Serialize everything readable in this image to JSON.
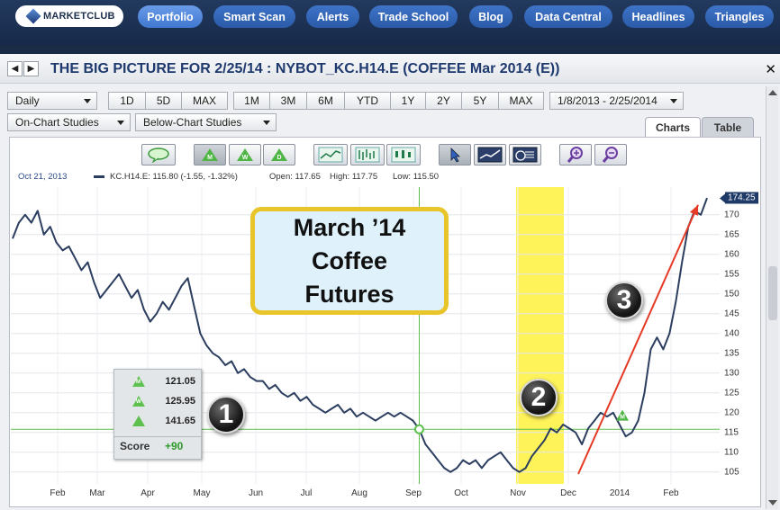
{
  "nav": {
    "logo": "MARKETCLUB",
    "items": [
      "Portfolio",
      "Smart Scan",
      "Alerts",
      "Trade School",
      "Blog",
      "Data Central",
      "Headlines",
      "Triangles"
    ],
    "active": "Portfolio"
  },
  "titlebar": {
    "title": "THE BIG PICTURE FOR 2/25/14 : NYBOT_KC.H14.E (COFFEE Mar 2014 (E))",
    "close": "✕"
  },
  "controls": {
    "period": "Daily",
    "ranges1": [
      "1D",
      "5D",
      "MAX"
    ],
    "ranges2": [
      "1M",
      "3M",
      "6M",
      "YTD",
      "1Y",
      "2Y",
      "5Y",
      "MAX"
    ],
    "date_range": "1/8/2013 - 2/25/2014",
    "on_chart": "On-Chart Studies",
    "below_chart": "Below-Chart Studies",
    "tabs": [
      "Charts",
      "Table"
    ],
    "active_tab": "Charts"
  },
  "toolbar_icons": [
    "speech-bubble-icon",
    "monthly-triangle-icon",
    "weekly-triangle-icon",
    "daily-triangle-icon",
    "line-chart-icon",
    "bar-chart-icon",
    "candlestick-chart-icon",
    "pointer-icon",
    "trendline-icon",
    "draw-tools-icon",
    "zoom-in-icon",
    "zoom-out-icon"
  ],
  "info": {
    "date": "Oct 21, 2013",
    "symbol_line": "KC.H14.E: 115.80 (-1.55, -1.32%)",
    "open": "Open: 117.65",
    "high": "High: 117.75",
    "low": "Low: 115.50"
  },
  "callout": {
    "line1": "March ’14",
    "line2": "Coffee",
    "line3": "Futures"
  },
  "score": {
    "rows": [
      {
        "letter": "M",
        "value": "121.05"
      },
      {
        "letter": "W",
        "value": "125.95"
      },
      {
        "letter": "",
        "value": "141.65"
      }
    ],
    "label": "Score",
    "result": "+90"
  },
  "badges": [
    "1",
    "2",
    "3"
  ],
  "chart_data": {
    "type": "line",
    "series": [
      {
        "name": "KC.H14.E",
        "values": [
          164,
          168,
          170,
          168,
          171,
          165,
          167,
          163,
          161,
          162,
          159,
          156,
          158,
          153,
          149,
          151,
          153,
          155,
          152,
          149,
          151,
          146,
          143,
          145,
          148,
          146,
          149,
          152,
          154,
          147,
          140,
          137,
          135,
          134,
          132,
          133,
          130,
          131,
          129,
          128,
          128,
          126,
          127,
          125,
          124,
          125,
          123,
          124,
          122,
          121,
          120,
          121,
          122,
          120,
          121,
          119,
          120,
          119,
          118,
          119,
          120,
          119,
          120,
          119,
          118,
          115.8,
          112,
          110,
          108,
          106,
          105,
          106,
          108,
          107,
          108,
          106,
          108,
          109,
          110,
          108,
          106,
          105,
          106,
          109,
          111,
          113,
          116,
          115,
          117,
          116,
          115,
          112,
          116,
          118,
          120,
          119,
          120,
          117,
          114,
          115,
          118,
          125,
          136,
          139,
          136,
          140,
          148,
          158,
          167,
          171,
          170,
          174.25
        ]
      }
    ],
    "y_ticks": [
      105,
      110,
      115,
      120,
      125,
      130,
      135,
      140,
      145,
      150,
      155,
      160,
      165,
      170
    ],
    "ylim": [
      102,
      177
    ],
    "x_labels": [
      "Feb",
      "Mar",
      "Apr",
      "May",
      "Jun",
      "Jul",
      "Aug",
      "Sep",
      "Oct",
      "Nov",
      "Dec",
      "2014",
      "Feb"
    ],
    "last_price": "174.25",
    "reference_line": 115.8,
    "highlight_period": "Nov",
    "annotations": [
      {
        "type": "arrow",
        "from": [
          104.5,
          "Dec"
        ],
        "to": [
          172.5,
          "Feb"
        ],
        "color": "#e53a25"
      },
      {
        "type": "signal-triangle",
        "label": "M",
        "y": 118
      },
      {
        "type": "marker",
        "y": 115.8,
        "date": "Oct 21, 2013"
      }
    ],
    "grid": true
  },
  "colors": {
    "nav_active": "#3f78d0",
    "price_line": "#2c3e5f",
    "highlight": "#fff35a",
    "arrow": "#e53a25",
    "reference": "#5ec04e",
    "score_positive": "#2e9a2a"
  }
}
